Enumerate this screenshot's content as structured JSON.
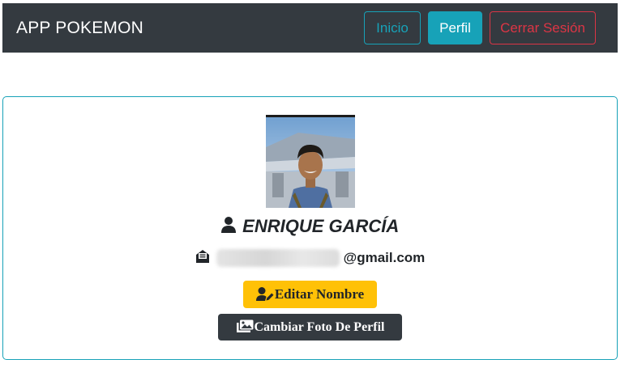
{
  "navbar": {
    "brand": "APP POKEMON",
    "links": {
      "home": "Inicio",
      "profile": "Perfil",
      "logout": "Cerrar Sesión"
    }
  },
  "profile": {
    "avatar_icon": "user-photo",
    "name_icon": "user-icon",
    "name": "ENRIQUE GARCÍA",
    "email_icon": "envelope-open-icon",
    "email_visible": "@gmail.com",
    "edit_icon": "user-edit-icon",
    "edit_button": "Editar Nombre",
    "photo_icon": "images-icon",
    "photo_button": "Cambiar Foto De Perfil"
  },
  "colors": {
    "navbar_bg": "#343a40",
    "info": "#17a2b8",
    "danger": "#dc3545",
    "warning": "#ffc107",
    "dark": "#343a40"
  }
}
